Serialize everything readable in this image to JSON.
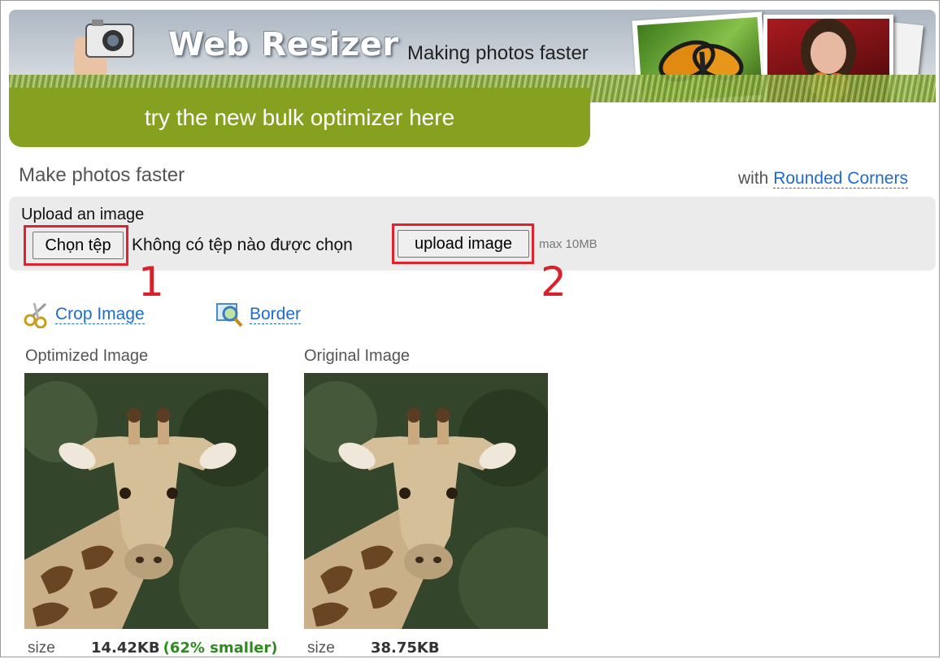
{
  "banner": {
    "title": "Web Resizer",
    "tagline": "Making photos faster",
    "bulk_link": "try the new bulk optimizer here"
  },
  "headline": {
    "title": "Make photos faster",
    "with_prefix": "with",
    "rounded_corners_link": "Rounded Corners"
  },
  "upload": {
    "label": "Upload an image",
    "choose_file_button": "Chọn tệp",
    "no_file_text": "Không có tệp nào được chọn",
    "upload_button": "upload image",
    "max_size": "max 10MB",
    "step1": "1",
    "step2": "2"
  },
  "tools": [
    {
      "label": "Crop Image",
      "icon": "scissors-icon"
    },
    {
      "label": "Border",
      "icon": "magnifier-icon"
    }
  ],
  "optimized": {
    "caption": "Optimized Image",
    "size_label": "size",
    "size_value": "14.42KB",
    "reduction": "(62% smaller)"
  },
  "original": {
    "caption": "Original Image",
    "size_label": "size",
    "size_value": "38.75KB"
  },
  "colors": {
    "bulk_green": "#86a11f",
    "link_blue": "#1e6bd1",
    "highlight_red": "#e0242f",
    "success_green": "#2e8b1f"
  }
}
